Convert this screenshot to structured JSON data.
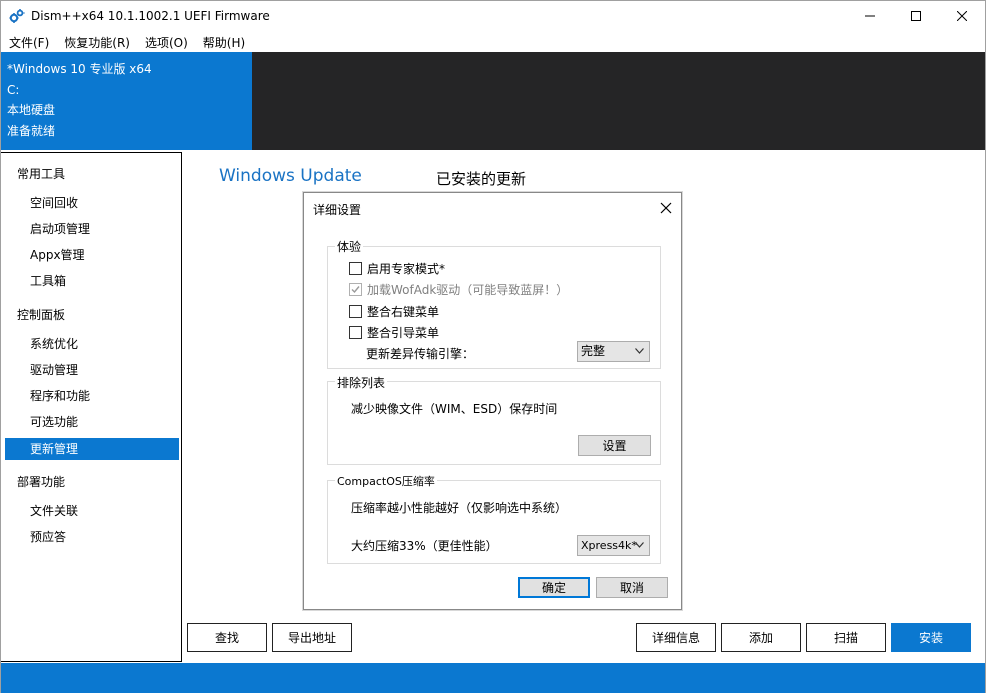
{
  "window": {
    "title": "Dism++x64 10.1.1002.1 UEFI Firmware",
    "icon": "gear-icon",
    "controls": [
      "minimize-icon",
      "maximize-icon",
      "close-icon"
    ]
  },
  "menubar": [
    "文件(F)",
    "恢复功能(R)",
    "选项(O)",
    "帮助(H)"
  ],
  "info": {
    "os": "*Windows 10 专业版 x64",
    "drive": "C:",
    "disk_type": "本地硬盘",
    "status": "准备就绪"
  },
  "sidebar": {
    "groups": [
      {
        "label": "常用工具",
        "items": [
          "空间回收",
          "启动项管理",
          "Appx管理",
          "工具箱"
        ]
      },
      {
        "label": "控制面板",
        "items": [
          "系统优化",
          "驱动管理",
          "程序和功能",
          "可选功能",
          "更新管理"
        ]
      },
      {
        "label": "部署功能",
        "items": [
          "文件关联",
          "预应答"
        ]
      }
    ],
    "active_item": "更新管理"
  },
  "main": {
    "title": "Windows Update",
    "subtitle": "已安装的更新",
    "buttons": {
      "find": "查找",
      "export": "导出地址",
      "details": "详细信息",
      "add": "添加",
      "scan": "扫描",
      "install": "安装"
    }
  },
  "dialog": {
    "title": "详细设置",
    "experience": {
      "legend": "体验",
      "options": [
        {
          "label": "启用专家模式*",
          "checked": false,
          "disabled": false
        },
        {
          "label": "加载WofAdk驱动（可能导致蓝屏！）",
          "checked": true,
          "disabled": true
        },
        {
          "label": "整合右键菜单",
          "checked": false,
          "disabled": false
        },
        {
          "label": "整合引导菜单",
          "checked": false,
          "disabled": false
        }
      ],
      "engine_label": "更新差异传输引擎：",
      "engine_value": "完整"
    },
    "exclusion": {
      "legend": "排除列表",
      "text": "减少映像文件（WIM、ESD）保存时间",
      "button": "设置"
    },
    "compact": {
      "legend": "CompactOS压缩率",
      "text": "压缩率越小性能越好（仅影响选中系统）",
      "ratio_label": "大约压缩33%（更佳性能）",
      "ratio_value": "Xpress4k*"
    },
    "ok": "确定",
    "cancel": "取消"
  },
  "colors": {
    "accent": "#0b78d0",
    "dark_panel": "#252526",
    "title_link": "#1a73c4"
  }
}
